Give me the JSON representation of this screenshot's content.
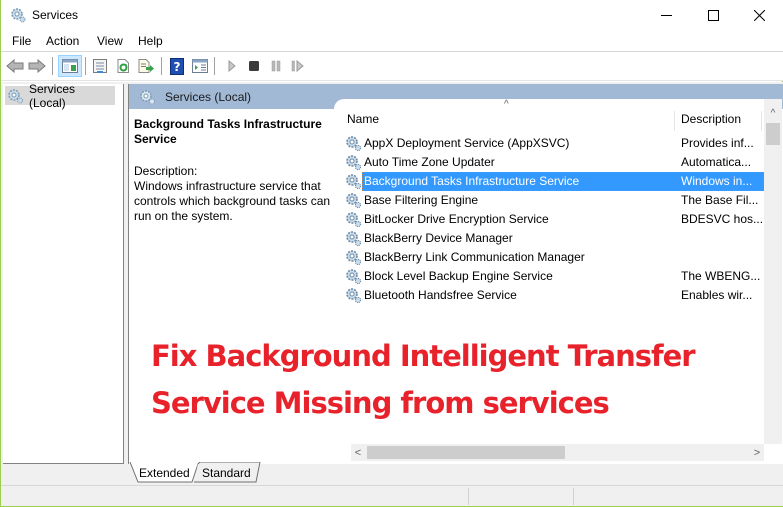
{
  "window": {
    "title": "Services",
    "controls": {
      "minimize": "–",
      "maximize": "☐",
      "close": "✕"
    }
  },
  "menu": [
    "File",
    "Action",
    "View",
    "Help"
  ],
  "toolbar": {
    "buttons": [
      {
        "name": "back",
        "icon": "arrow-left-icon"
      },
      {
        "name": "forward",
        "icon": "arrow-right-icon"
      },
      {
        "name": "show-hide-console-tree",
        "icon": "console-tree-icon",
        "active": true
      },
      {
        "name": "properties",
        "icon": "properties-icon"
      },
      {
        "name": "refresh",
        "icon": "refresh-icon"
      },
      {
        "name": "export-list",
        "icon": "export-icon"
      },
      {
        "name": "help",
        "icon": "help-icon",
        "glyph": "?"
      },
      {
        "name": "show-action-pane",
        "icon": "action-pane-icon"
      },
      {
        "name": "start-service",
        "icon": "play-icon"
      },
      {
        "name": "stop-service",
        "icon": "stop-icon"
      },
      {
        "name": "pause-service",
        "icon": "pause-icon"
      },
      {
        "name": "restart-service",
        "icon": "restart-icon"
      }
    ]
  },
  "tree": {
    "root_label": "Services (Local)"
  },
  "content": {
    "header_label": "Services (Local)",
    "selected_service_title": "Background Tasks Infrastructure Service",
    "description_label": "Description:",
    "description_text": "Windows infrastructure service that controls which background tasks can run on the system.",
    "columns": {
      "name": "Name",
      "description": "Description"
    },
    "sort_indicator": "^",
    "services": [
      {
        "name": "AppX Deployment Service (AppXSVC)",
        "description": "Provides inf..."
      },
      {
        "name": "Auto Time Zone Updater",
        "description": "Automatica..."
      },
      {
        "name": "Background Tasks Infrastructure Service",
        "description": "Windows in...",
        "selected": true
      },
      {
        "name": "Base Filtering Engine",
        "description": "The Base Fil..."
      },
      {
        "name": "BitLocker Drive Encryption Service",
        "description": "BDESVC hos..."
      },
      {
        "name": "BlackBerry Device Manager",
        "description": ""
      },
      {
        "name": "BlackBerry Link Communication Manager",
        "description": ""
      },
      {
        "name": "Block Level Backup Engine Service",
        "description": "The WBENG..."
      },
      {
        "name": "Bluetooth Handsfree Service",
        "description": "Enables wir..."
      }
    ]
  },
  "overlay": {
    "line1": "Fix Background Intelligent Transfer",
    "line2": "Service Missing from services",
    "color": "#e8222a"
  },
  "tabs": [
    "Extended",
    "Standard"
  ],
  "scroll": {
    "up": "^",
    "left": "<",
    "right": ">"
  },
  "colors": {
    "selection": "#3399ff",
    "header_band": "#a2b9d6",
    "window_border": "#9ccf4f"
  }
}
